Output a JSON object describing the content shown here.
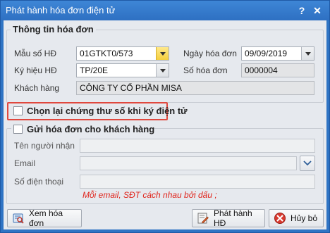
{
  "window": {
    "title": "Phát hành hóa đơn điện tử",
    "help_label": "?",
    "close_label": "✕"
  },
  "invoice_info": {
    "group_title": "Thông tin hóa đơn",
    "form_template_label": "Mẫu số HĐ",
    "form_template_value": "01GTKT0/573",
    "serial_label": "Ký hiệu HĐ",
    "serial_value": "TP/20E",
    "customer_label": "Khách hàng",
    "customer_value": "CÔNG TY CỔ PHẦN MISA",
    "invoice_date_label": "Ngày hóa đơn",
    "invoice_date_value": "09/09/2019",
    "invoice_number_label": "Số hóa đơn",
    "invoice_number_value": "0000004"
  },
  "reselect_certificate": {
    "label": "Chọn lại chứng thư số khi ký điện tử",
    "checked": false
  },
  "send_to_customer": {
    "label": "Gửi hóa đơn cho khách hàng",
    "checked": false,
    "recipient_label": "Tên người nhận",
    "recipient_value": "",
    "email_label": "Email",
    "email_value": "",
    "phone_label": "Số điện thoại",
    "phone_value": "",
    "note": "Mỗi email, SĐT cách nhau bởi dấu ;"
  },
  "buttons": {
    "view_invoice": "Xem hóa đơn",
    "issue_invoice": "Phát hành HĐ",
    "cancel": "Hủy bỏ"
  },
  "colors": {
    "titlebar": "#2e70c2",
    "highlight": "#e0483e",
    "note": "#e0241b"
  }
}
